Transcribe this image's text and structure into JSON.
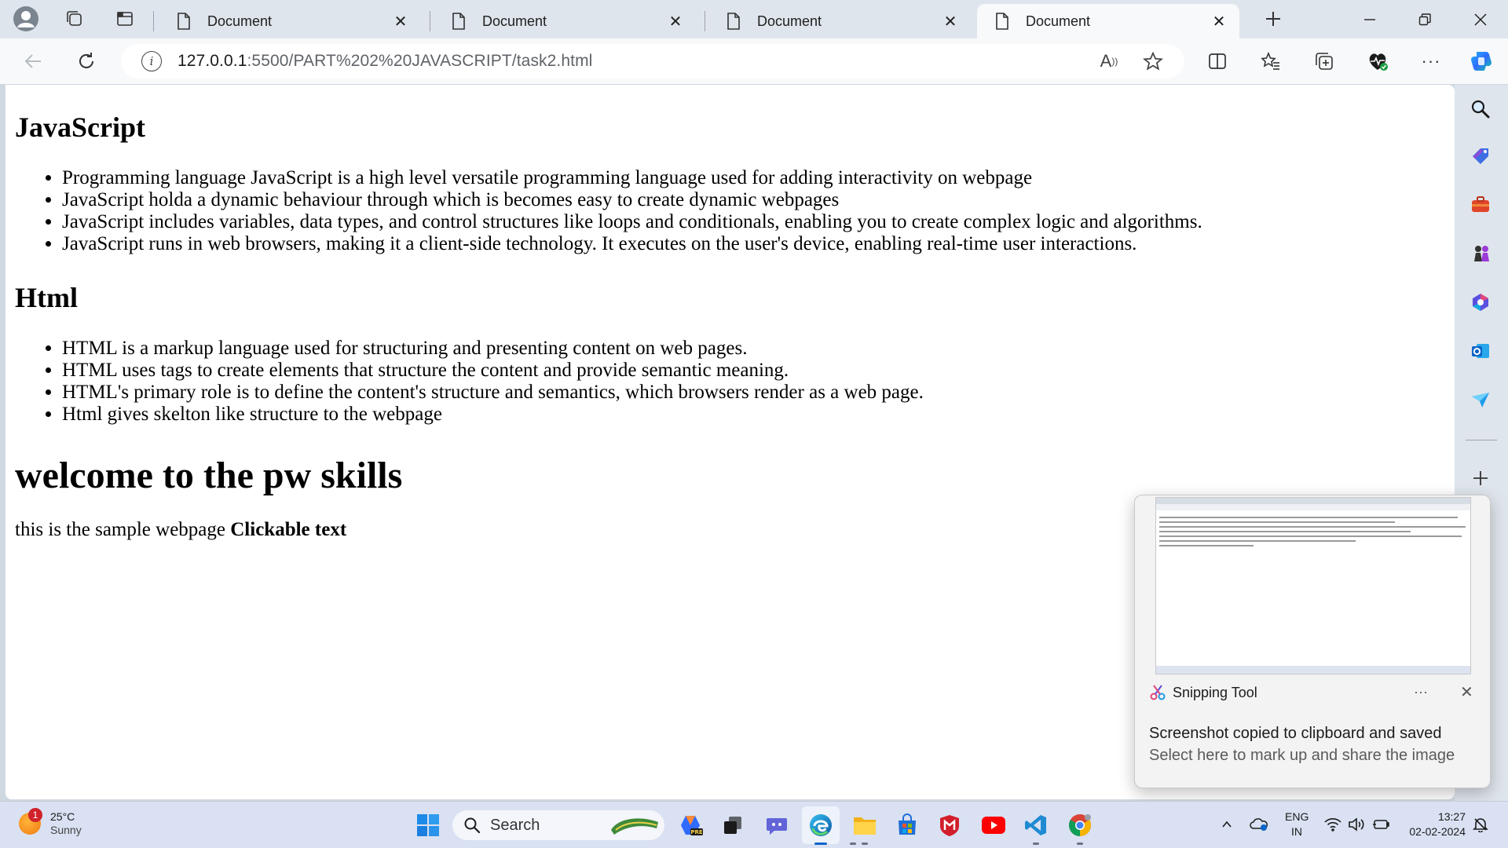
{
  "browser": {
    "tabs": [
      {
        "label": "Document",
        "active": false
      },
      {
        "label": "Document",
        "active": false
      },
      {
        "label": "Document",
        "active": false
      },
      {
        "label": "Document",
        "active": true
      }
    ],
    "address": {
      "host": "127.0.0.1",
      "path": ":5500/PART%202%20JAVASCRIPT/task2.html"
    },
    "read_aloud_label": "A"
  },
  "page": {
    "sections": [
      {
        "heading": "JavaScript",
        "items": [
          "Programming language JavaScript is a high level versatile programming language used for adding interactivity on webpage",
          "JavaScript holda a dynamic behaviour through which is becomes easy to create dynamic webpages",
          "JavaScript includes variables, data types, and control structures like loops and conditionals, enabling you to create complex logic and algorithms.",
          "JavaScript runs in web browsers, making it a client-side technology. It executes on the user's device, enabling real-time user interactions."
        ]
      },
      {
        "heading": "Html",
        "items": [
          "HTML is a markup language used for structuring and presenting content on web pages.",
          "HTML uses tags to create elements that structure the content and provide semantic meaning.",
          "HTML's primary role is to define the content's structure and semantics, which browsers render as a web page.",
          "Html gives skelton like structure to the webpage"
        ]
      }
    ],
    "welcome": "welcome to the pw skills",
    "paragraph": "this is the sample webpage",
    "clickable": "Clickable text"
  },
  "toast": {
    "app_name": "Snipping Tool",
    "more": "···",
    "close": "✕",
    "message": "Screenshot copied to clipboard and saved",
    "sub": "Select here to mark up and share the image"
  },
  "taskbar": {
    "weather": {
      "temp": "25°C",
      "condition": "Sunny",
      "badge": "1"
    },
    "search_label": "Search",
    "language": {
      "line1": "ENG",
      "line2": "IN"
    },
    "clock": {
      "time": "13:27",
      "date": "02-02-2024"
    }
  },
  "colors": {
    "accent": "#0a64c8",
    "tab_bar": "#dfe5ec",
    "taskbar": "#d9e1f2"
  }
}
